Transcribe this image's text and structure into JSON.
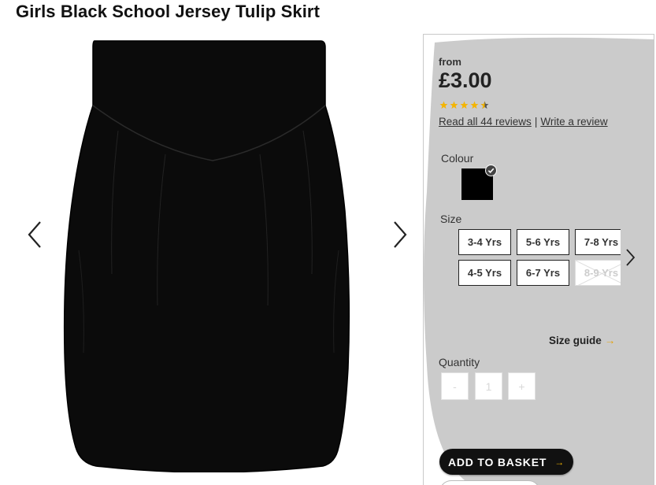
{
  "product": {
    "title": "Girls Black School Jersey Tulip Skirt"
  },
  "gallery": {
    "prev_icon": "chevron-left-icon",
    "next_icon": "chevron-right-icon"
  },
  "pricing": {
    "from_label": "from",
    "price": "£3.00"
  },
  "rating": {
    "stars": 4.5,
    "max": 5,
    "star_color": "#f4b400",
    "read_reviews": "Read all 44 reviews",
    "separator": "|",
    "write_review": "Write a review"
  },
  "colour": {
    "label": "Colour",
    "selected": "#000000"
  },
  "size": {
    "label": "Size",
    "options": [
      {
        "label": "3-4 Yrs",
        "available": true
      },
      {
        "label": "4-5 Yrs",
        "available": true
      },
      {
        "label": "5-6 Yrs",
        "available": true
      },
      {
        "label": "6-7 Yrs",
        "available": true
      },
      {
        "label": "7-8 Yrs",
        "available": true
      },
      {
        "label": "8-9 Yrs",
        "available": false
      }
    ],
    "guide_label": "Size guide",
    "guide_arrow": "→"
  },
  "quantity": {
    "label": "Quantity",
    "minus": "-",
    "value": "1",
    "plus": "+"
  },
  "basket": {
    "label": "ADD TO BASKET",
    "arrow": "→"
  }
}
